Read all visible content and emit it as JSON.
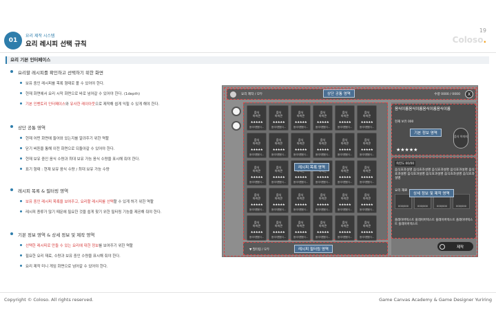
{
  "header": {
    "badge": "01",
    "sup_title": "요리 제작 시스템",
    "title": "요리 레시피 선택 규칙",
    "page_number": "19",
    "logo_text": "Coloso",
    "logo_dot": "."
  },
  "section": {
    "title": "요리 기본 인터페이스"
  },
  "bullets": [
    {
      "head": "요리할 레시피를 확인하고 선택하기 위한 화면",
      "items": [
        {
          "text": "보유 중인 레시피를 목록 형태로 볼 수 있어야 한다."
        },
        {
          "text": "현재 화면에서 요리 시작 화면으로 바로 넘어갈 수 있어야 한다. (1depth)"
        },
        {
          "red": "기본 인벤토리 인터페이스",
          "text": "와 ",
          "red2": "유사한 레이아웃",
          "tail": "으로 제작해 쉽게 익힐 수 있게 해야 한다."
        }
      ]
    },
    {
      "head": "상단 공통 영역",
      "items": [
        {
          "text": "현재 어떤 화면에 들어와 있는지를 알려주기 위한 역할"
        },
        {
          "text": "닫기 버튼을 통해 이전 화면으로 되돌아갈 수 있어야 한다."
        },
        {
          "text": "현재 보유 중인 음식 수량과 최대 보유 가능 음식 수량을 표시해 줘야 한다."
        },
        {
          "text": "표기 형태 : 현재 보유 음식 수량 / 최대 보유 가능 수량"
        }
      ]
    },
    {
      "head": "레시피 목록 & 필터링 영역",
      "items": [
        {
          "red": "보유 중인 레시피 목록을 보여주고, 요리할 레시피를 선택",
          "tail": "할 수 있게 하기 위한 역할"
        },
        {
          "text": "레시피 종류가 많기 때문에 필요한 것을 쉽게 찾기 위한 필터링 기능을 제공해 줘야 한다."
        }
      ]
    },
    {
      "head": "기본 정보 영역 & 상세 정보 및 제작 영역",
      "items": [
        {
          "red": "선택한 레시피로 만들 수 있는 요리에 대한 정보",
          "tail": "를 보여주기 위한 역할"
        },
        {
          "text": "필요한 요리 재료, 수량과 보유 중인 수량을 표시해 줘야 한다."
        },
        {
          "text": "요리 제작 미니 게임 화면으로 넘어갈 수 있어야 한다."
        }
      ]
    }
  ],
  "mockup": {
    "topbar_label": "요리 제작 / 모두",
    "topbar_area_label": "상단 공통 영역",
    "count_text": "수량 0000 / 0000",
    "close_icon": "X",
    "card": {
      "title_line1": "음식",
      "title_line2": "아이콘",
      "stars": "★★★★★",
      "name": "음식이름음식..."
    },
    "recipe_list_label": "레시피 목록 영역",
    "filter_text": "필터링 / 모두",
    "filter_area_label": "레시피 필터링 영역",
    "info": {
      "title": "음식이름음식이름음식이름음식이름",
      "owned": "현재 보유 000",
      "area_label": "기본 정보 영역",
      "image_text": "음식 이미지",
      "stars": "★★★★★"
    },
    "detail": {
      "badge": "숙련도 00/00",
      "desc": "음식효과설명 음식효과설명 음식효과설명 음식효과설명 음식효과설명 음식효과설명 음식효과설명 음식효과설명 음식효과설명",
      "material_title": "요리 재료",
      "area_label": "상세 정보 및 제작 영역",
      "materials": [
        "000/000",
        "000/000",
        "000/000",
        "000/000"
      ],
      "text": "플레이버텍스트 플레이버텍스트 플레이버텍스트 플레이버텍스트 플레이버텍스트"
    },
    "make_button": "제작"
  },
  "footer": {
    "left": "Copyright © Coloso. All rights reserved.",
    "right": "Game Canvas Academy & Game Designer Yuriring"
  }
}
